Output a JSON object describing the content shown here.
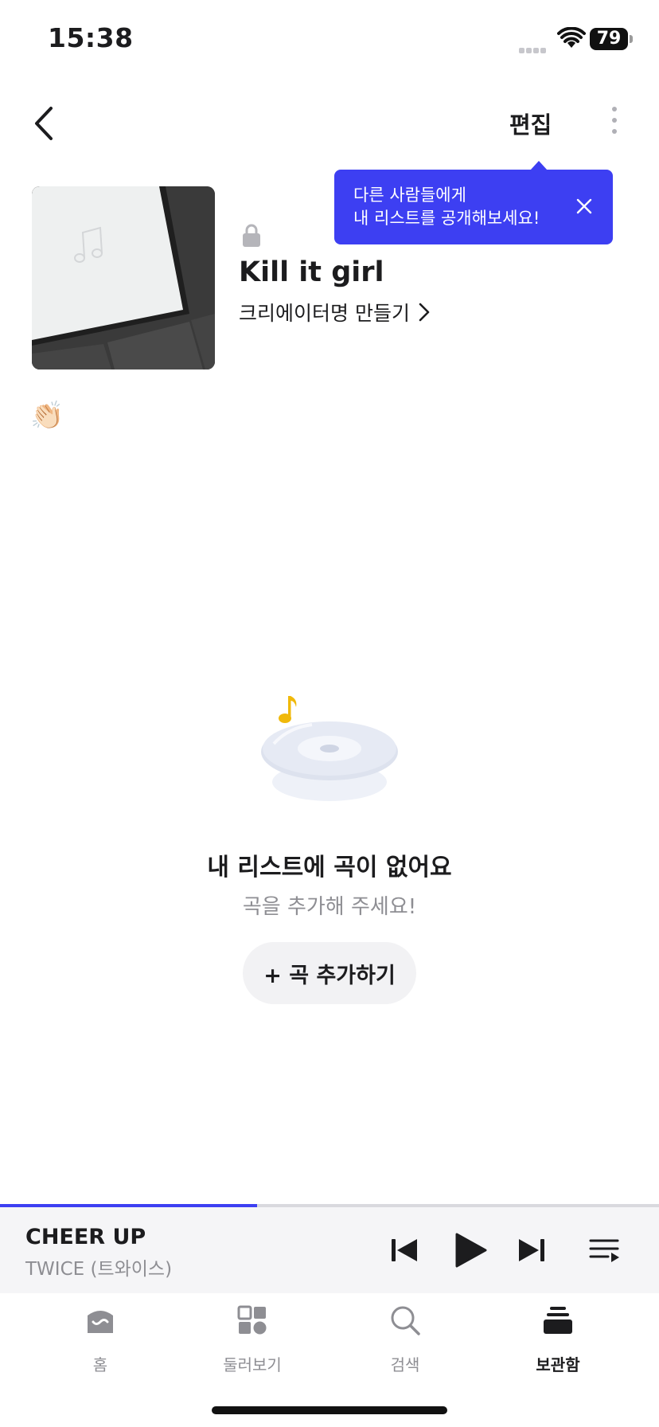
{
  "status_bar": {
    "time": "15:38",
    "battery": "79"
  },
  "header": {
    "edit_label": "편집"
  },
  "tooltip": {
    "line1": "다른 사람들에게",
    "line2": "내 리스트를 공개해보세요!"
  },
  "playlist": {
    "title": "Kill it girl",
    "creator_link": "크리에이터명 만들기",
    "description_emoji": "👏🏻"
  },
  "empty_state": {
    "title": "내 리스트에 곡이 없어요",
    "subtitle": "곡을 추가해 주세요!",
    "add_button": "+ 곡 추가하기"
  },
  "player": {
    "song_title": "CHEER UP",
    "artist": "TWICE (트와이스)",
    "progress": 0.39
  },
  "tabs": [
    {
      "label": "홈",
      "icon": "home-icon"
    },
    {
      "label": "둘러보기",
      "icon": "browse-grid-icon"
    },
    {
      "label": "검색",
      "icon": "search-icon"
    },
    {
      "label": "보관함",
      "icon": "library-icon",
      "active": true
    }
  ],
  "colors": {
    "accent": "#3d3ff2",
    "player_bg": "#f5f5f7"
  }
}
